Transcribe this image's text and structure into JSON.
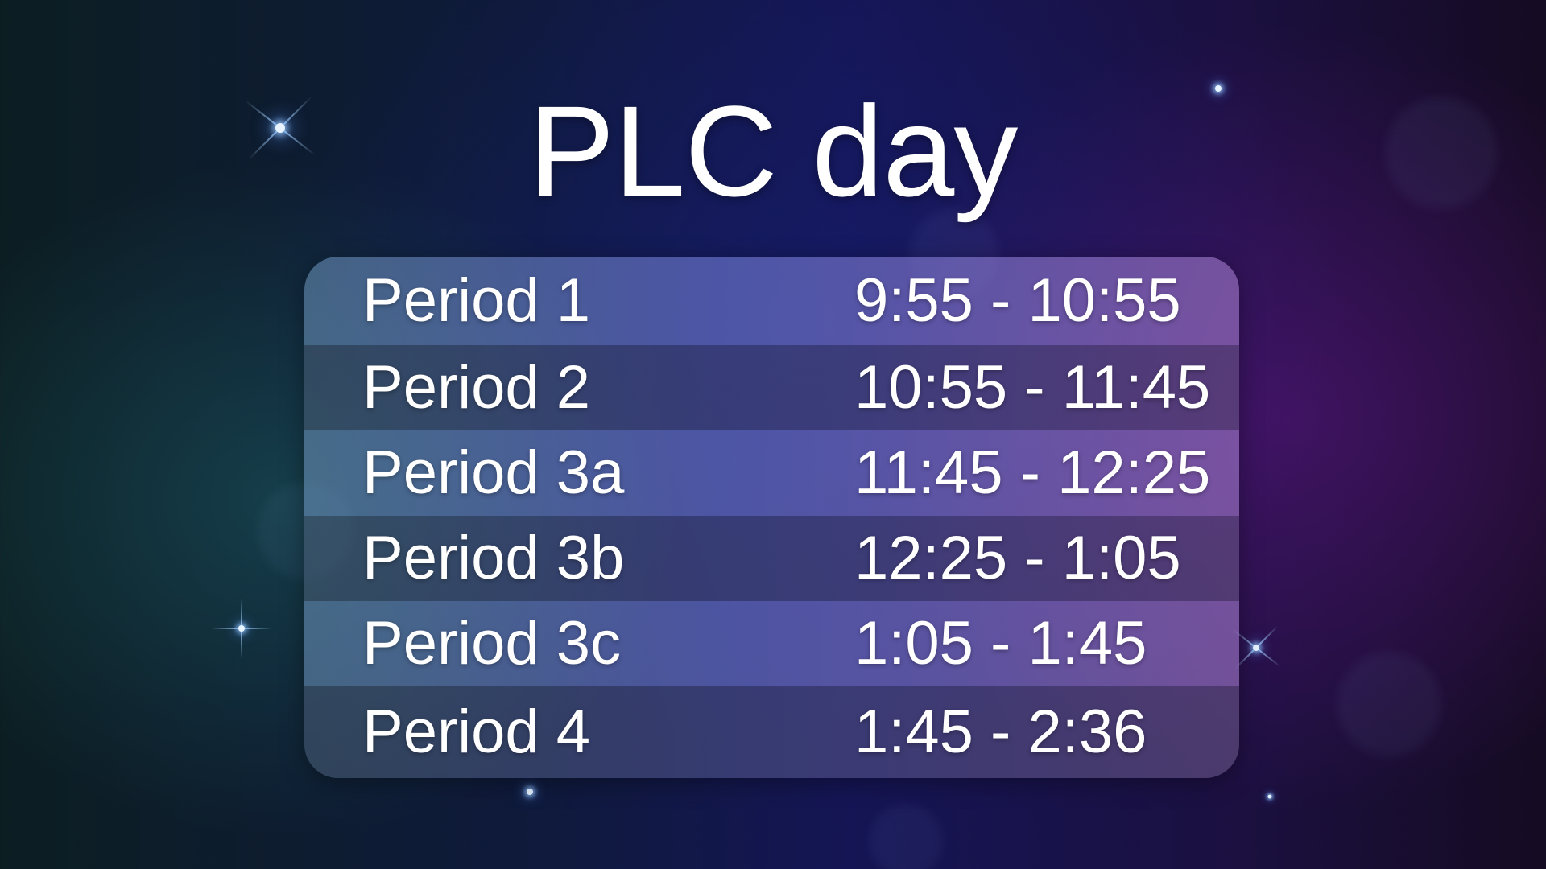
{
  "title": "PLC day",
  "schedule": [
    {
      "period": "Period 1",
      "time": "9:55 - 10:55"
    },
    {
      "period": "Period 2",
      "time": "10:55 - 11:45"
    },
    {
      "period": "Period 3a",
      "time": "11:45 - 12:25"
    },
    {
      "period": "Period 3b",
      "time": "12:25 - 1:05"
    },
    {
      "period": "Period 3c",
      "time": "1:05 - 1:45"
    },
    {
      "period": "Period 4",
      "time": "1:45 - 2:36"
    }
  ],
  "colors": {
    "background_left": "#0c1e22",
    "background_center": "#151555",
    "background_right": "#150b22",
    "text": "#ffffff"
  }
}
